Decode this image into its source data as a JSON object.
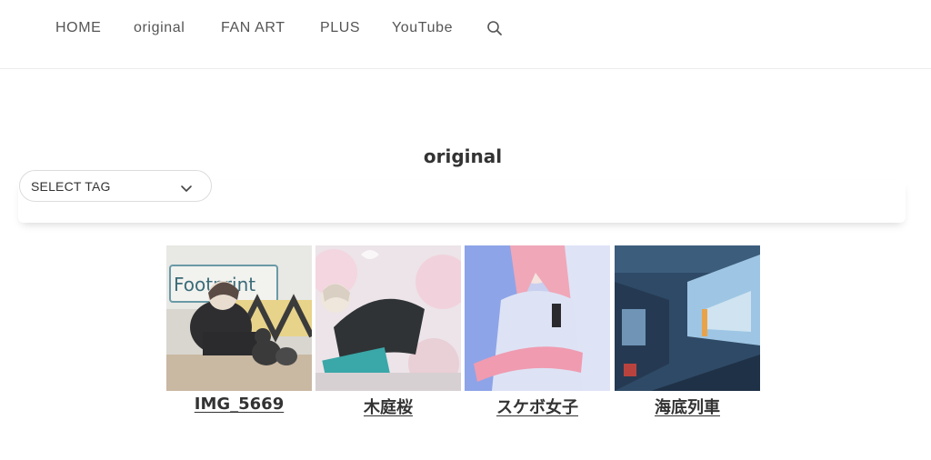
{
  "nav": {
    "items": [
      {
        "label": "HOME"
      },
      {
        "label": "original"
      },
      {
        "label": "FAN ART"
      },
      {
        "label": "PLUS"
      },
      {
        "label": "YouTube"
      }
    ],
    "search_icon": "search-icon"
  },
  "page": {
    "title": "original"
  },
  "filter": {
    "select_label": "SELECT TAG",
    "chevron_icon": "chevron-down-icon"
  },
  "gallery": {
    "items": [
      {
        "title": "IMG_5669",
        "sign_text": "Footprint"
      },
      {
        "title": "木庭桜"
      },
      {
        "title": "スケボ女子"
      },
      {
        "title": "海底列車"
      }
    ]
  }
}
